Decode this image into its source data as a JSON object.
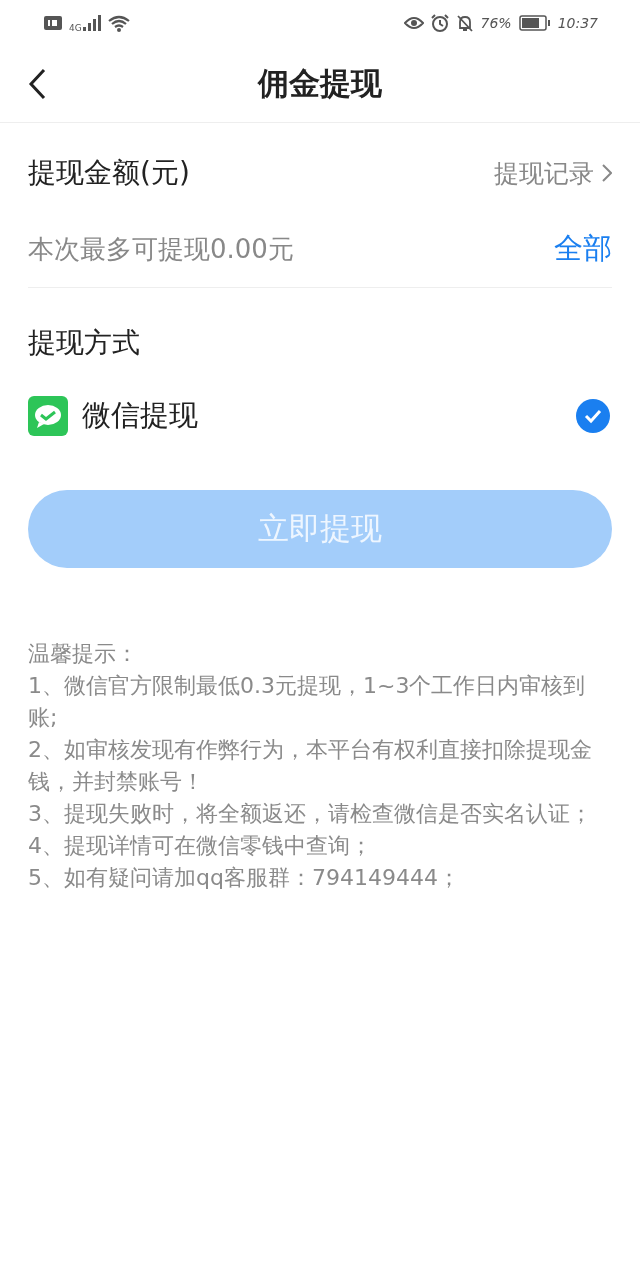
{
  "status_bar": {
    "network": "4G",
    "battery": "76%",
    "time": "10:37"
  },
  "header": {
    "title": "佣金提现"
  },
  "amount": {
    "label": "提现金额(元)",
    "record_link": "提现记录",
    "placeholder": "本次最多可提现0.00元",
    "all_button": "全部"
  },
  "methods": {
    "title": "提现方式",
    "items": [
      {
        "label": "微信提现",
        "selected": true
      }
    ]
  },
  "submit": {
    "label": "立即提现",
    "disabled": true
  },
  "notes": [
    "温馨提示：",
    "1、微信官方限制最低0.3元提现，1~3个工作日内审核到账;",
    "2、如审核发现有作弊行为，本平台有权利直接扣除提现金钱，并封禁账号！",
    "3、提现失败时，将全额返还，请检查微信是否实名认证；",
    "4、提现详情可在微信零钱中查询；",
    "5、如有疑问请加qq客服群：794149444；"
  ]
}
